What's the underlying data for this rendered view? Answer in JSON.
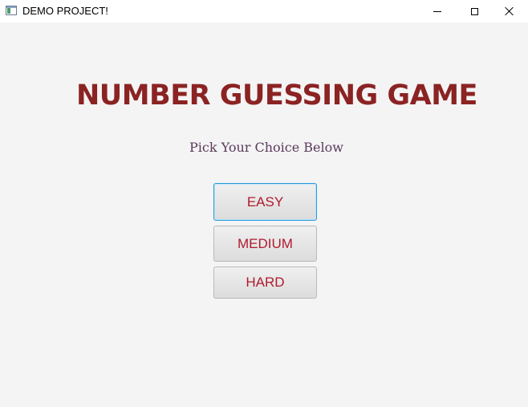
{
  "window": {
    "title": "DEMO PROJECT!"
  },
  "main": {
    "heading": "NUMBER GUESSING GAME",
    "subtitle": "Pick Your Choice Below",
    "choices": [
      {
        "label": "EASY",
        "focused": true
      },
      {
        "label": "MEDIUM",
        "focused": false
      },
      {
        "label": "HARD",
        "focused": false
      }
    ]
  },
  "colors": {
    "heading": "#8b2323",
    "subtitle": "#5a3a5a",
    "button_text": "#b01a2e",
    "focus_border": "#2a9ad8",
    "background": "#f4f4f4"
  },
  "icons": {
    "app": "app-window-icon",
    "minimize": "minimize-icon",
    "maximize": "maximize-icon",
    "close": "close-icon"
  }
}
